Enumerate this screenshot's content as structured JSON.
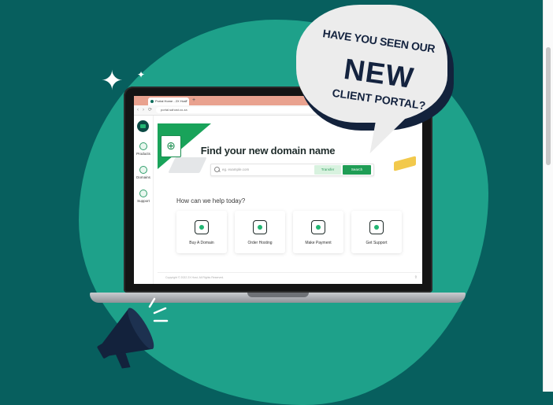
{
  "promo": {
    "line1": "HAVE YOU SEEN OUR",
    "line2": "NEW",
    "line3": "CLIENT PORTAL?"
  },
  "browser": {
    "tab_title": "Portal Home - 2X Host",
    "new_tab": "+",
    "url": "portal.sahost.co.za",
    "nav_back": "‹",
    "nav_forward": "›",
    "nav_reload": "⟳"
  },
  "sidebar": {
    "items": [
      {
        "label": "Products",
        "icon": "box-icon"
      },
      {
        "label": "Domains",
        "icon": "globe-icon"
      },
      {
        "label": "Support",
        "icon": "chat-icon"
      }
    ]
  },
  "portal": {
    "headline": "Find your new domain name",
    "search_placeholder": "eg. example.com",
    "transfer_label": "Transfer",
    "search_label": "Search",
    "help_heading": "How can we help today?",
    "cards": [
      {
        "label": "Buy A Domain",
        "icon": "domain-icon"
      },
      {
        "label": "Order Hosting",
        "icon": "hosting-box-icon"
      },
      {
        "label": "Make Payment",
        "icon": "payment-box-icon"
      },
      {
        "label": "Get Support",
        "icon": "support-chat-icon"
      }
    ],
    "footer": "Copyright © 2022 2X Host. All Rights Reserved."
  },
  "colors": {
    "background": "#075f5e",
    "blob": "#1ea18a",
    "brand_green": "#1f9d55",
    "bubble_text": "#14233f"
  }
}
